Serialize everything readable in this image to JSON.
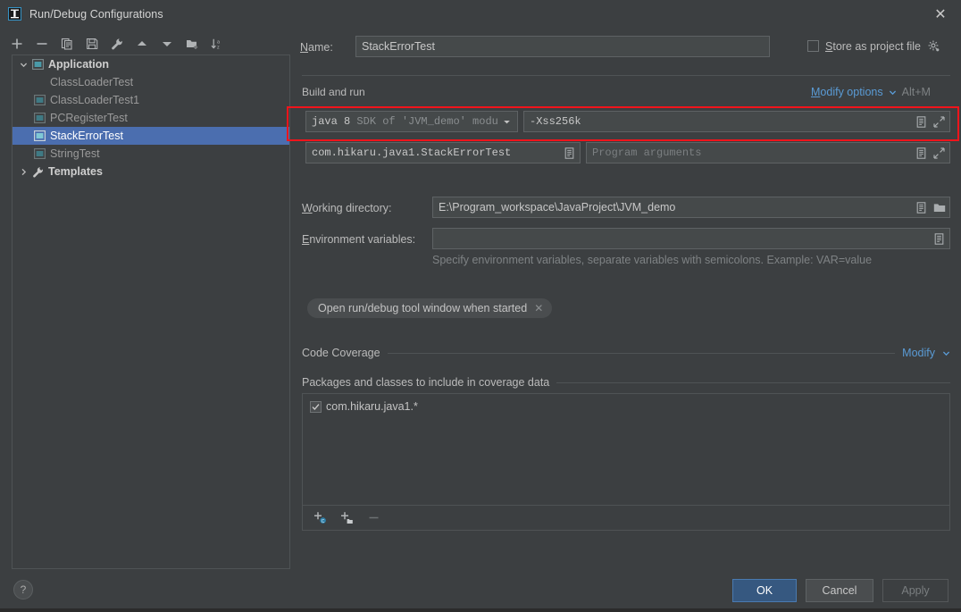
{
  "window": {
    "title": "Run/Debug Configurations",
    "app_icon": "intellij-idea-icon",
    "close_label": "✕"
  },
  "left_panel": {
    "toolbar": [
      {
        "name": "add-configuration-button",
        "icon": "plus-icon",
        "label": "+"
      },
      {
        "name": "remove-configuration-button",
        "icon": "minus-icon",
        "label": "−"
      },
      {
        "name": "copy-configuration-button",
        "icon": "copy-icon",
        "label": "Copy"
      },
      {
        "name": "save-configuration-button",
        "icon": "save-icon",
        "label": "Save"
      },
      {
        "name": "edit-templates-button",
        "icon": "wrench-icon",
        "label": "Edit Templates"
      },
      {
        "name": "move-up-button",
        "icon": "arrow-up-icon",
        "label": "Move Up"
      },
      {
        "name": "move-down-button",
        "icon": "arrow-down-icon",
        "label": "Move Down"
      },
      {
        "name": "new-folder-button",
        "icon": "folder-add-icon",
        "label": "New Folder"
      },
      {
        "name": "sort-configurations-button",
        "icon": "sort-az-icon",
        "label": "Sort"
      }
    ],
    "tree": [
      {
        "label": "Application",
        "level": 0,
        "icon": "application-icon",
        "twisty": "chevron-down-icon",
        "bold": true,
        "selected": false
      },
      {
        "label": "ClassLoaderTest",
        "level": 1,
        "icon": "none",
        "twisty": "none",
        "bold": false,
        "selected": false
      },
      {
        "label": "ClassLoaderTest1",
        "level": 1,
        "icon": "application-icon",
        "twisty": "none",
        "bold": false,
        "selected": false
      },
      {
        "label": "PCRegisterTest",
        "level": 1,
        "icon": "application-icon",
        "twisty": "none",
        "bold": false,
        "selected": false
      },
      {
        "label": "StackErrorTest",
        "level": 1,
        "icon": "application-icon",
        "twisty": "none",
        "bold": false,
        "selected": true
      },
      {
        "label": "StringTest",
        "level": 1,
        "icon": "application-icon",
        "twisty": "none",
        "bold": false,
        "selected": false
      },
      {
        "label": "Templates",
        "level": 0,
        "icon": "wrench-icon",
        "twisty": "chevron-right-icon",
        "bold": true,
        "selected": false
      }
    ],
    "help_button": "?"
  },
  "main": {
    "name_label": "Name:",
    "name_value": "StackErrorTest",
    "store_as_project_file_label": "Store as project file",
    "store_as_project_file_checked": false,
    "store_gear_icon": "gear-icon",
    "build_and_run": {
      "section_title": "Build and run",
      "modify_options_label": "Modify options",
      "modify_options_shortcut": "Alt+M",
      "jre_value_prefix": "java 8",
      "jre_value_suffix": "SDK of 'JVM_demo' modul",
      "vm_options_value": "-Xss256k",
      "main_class_value": "com.hikaru.java1.StackErrorTest",
      "program_arguments_placeholder": "Program arguments"
    },
    "working_directory_label": "Working directory:",
    "working_directory_value": "E:\\Program_workspace\\JavaProject\\JVM_demo",
    "environment_variables_label": "Environment variables:",
    "environment_variables_value": "",
    "environment_hint": "Specify environment variables, separate variables with semicolons. Example: VAR=value",
    "option_chip_label": "Open run/debug tool window when started",
    "option_chip_close": "✕",
    "code_coverage": {
      "section_title": "Code Coverage",
      "modify_label": "Modify",
      "packages_title": "Packages and classes to include in coverage data",
      "items": [
        {
          "label": "com.hikaru.java1.*",
          "checked": true
        }
      ],
      "toolbar": [
        {
          "name": "add-class-button",
          "icon": "add-class-icon"
        },
        {
          "name": "add-package-button",
          "icon": "add-package-icon"
        },
        {
          "name": "remove-pattern-button",
          "icon": "minus-icon"
        }
      ]
    }
  },
  "footer": {
    "ok_label": "OK",
    "cancel_label": "Cancel",
    "apply_label": "Apply"
  },
  "annotation": {
    "highlight_color": "#f1141b",
    "highlight_target": "jre-and-vm-options-row"
  },
  "colors": {
    "dialog_bg": "#3c3f41",
    "field_bg": "#45494a",
    "selection_blue": "#4b6eaf",
    "link_blue": "#5a9bd5",
    "primary_button": "#365880"
  }
}
